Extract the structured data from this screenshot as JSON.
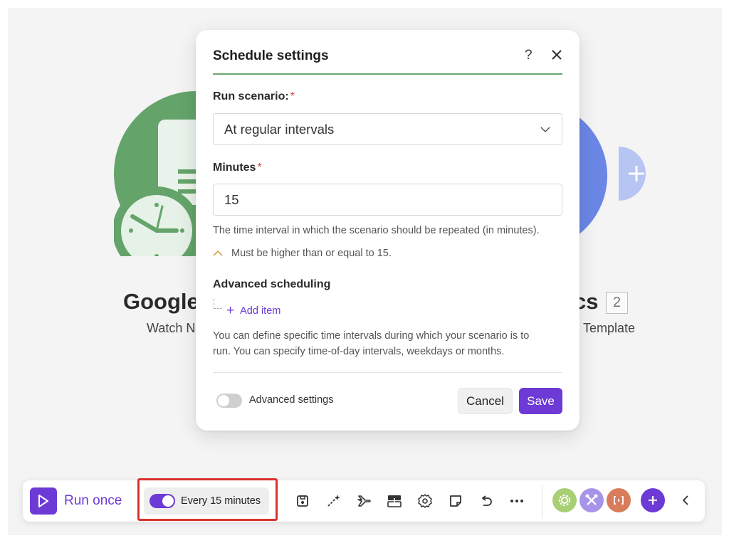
{
  "dialog": {
    "title": "Schedule settings",
    "help": "?",
    "run_scenario": {
      "label": "Run scenario:",
      "required": "*",
      "value": "At regular intervals"
    },
    "minutes": {
      "label": "Minutes",
      "required": "*",
      "value": "15",
      "help": "The time interval in which the scenario should be repeated (in minutes).",
      "warning": "Must be higher than or equal to 15."
    },
    "advanced_scheduling": {
      "title": "Advanced scheduling",
      "add_item": "Add item",
      "description_line1": "You can define specific time intervals during which your scenario is to",
      "description_line2": "run. You can specify time-of-day intervals, weekdays or months."
    },
    "advanced_settings_label": "Advanced settings",
    "advanced_settings_enabled": false,
    "cancel_label": "Cancel",
    "save_label": "Save"
  },
  "background": {
    "module1_title": "Google",
    "module1_sub": "Watch N",
    "module2_title": "cs",
    "module2_sub": "Template",
    "module2_badge": "2"
  },
  "toolbar": {
    "run_once_label": "Run once",
    "schedule_label": "Every 15 minutes",
    "schedule_enabled": true,
    "tools": [
      "save-icon",
      "magic-wand-icon",
      "airplane-icon",
      "explain-flow-icon",
      "gear-icon",
      "note-icon",
      "undo-icon",
      "more-icon"
    ],
    "apps": [
      "tools-app-icon",
      "flow-control-app-icon",
      "json-app-icon",
      "add-module-icon",
      "collapse-icon"
    ]
  },
  "colors": {
    "accent": "#6d3ad6",
    "google_green": "#64a46a",
    "module_blue": "#6b87e6",
    "highlight_red": "#d9322a",
    "required": "#d14343"
  }
}
